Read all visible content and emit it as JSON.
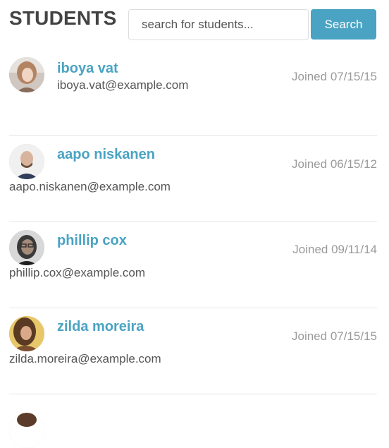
{
  "header": {
    "title": "STUDENTS",
    "search_placeholder": "search for students...",
    "search_button": "Search"
  },
  "students": [
    {
      "name": "iboya vat",
      "email": "iboya.vat@example.com",
      "joined": "Joined 07/15/15",
      "avatar_icon": "avatar-photo"
    },
    {
      "name": "aapo niskanen",
      "email": "aapo.niskanen@example.com",
      "joined": "Joined 06/15/12",
      "avatar_icon": "avatar-photo"
    },
    {
      "name": "phillip cox",
      "email": "phillip.cox@example.com",
      "joined": "Joined 09/11/14",
      "avatar_icon": "avatar-photo"
    },
    {
      "name": "zilda moreira",
      "email": "zilda.moreira@example.com",
      "joined": "Joined 07/15/15",
      "avatar_icon": "avatar-photo"
    }
  ],
  "colors": {
    "accent": "#4aa3c3",
    "title": "#434343",
    "text": "#555555",
    "muted": "#9a9a9a",
    "divider": "#e5e5e5"
  }
}
